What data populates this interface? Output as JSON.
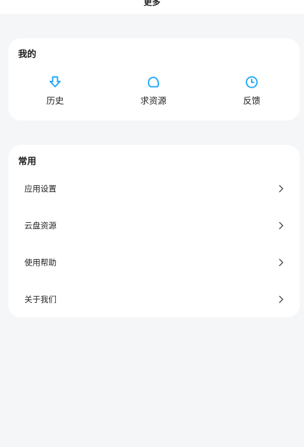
{
  "header": {
    "title": "更多"
  },
  "mine": {
    "title": "我的",
    "items": [
      {
        "label": "历史",
        "icon": "history-arrow-icon"
      },
      {
        "label": "求资源",
        "icon": "request-bubble-icon"
      },
      {
        "label": "反馈",
        "icon": "feedback-clock-icon"
      }
    ]
  },
  "common": {
    "title": "常用",
    "items": [
      {
        "label": "应用设置",
        "icon": "chevron-right-icon"
      },
      {
        "label": "云盘资源",
        "icon": "chevron-right-icon"
      },
      {
        "label": "使用帮助",
        "icon": "chevron-right-icon"
      },
      {
        "label": "关于我们",
        "icon": "chevron-right-icon"
      }
    ]
  },
  "colors": {
    "accent": "#1ea7fb",
    "background": "#f5f6f8",
    "card": "#ffffff",
    "chevron": "#555555"
  }
}
